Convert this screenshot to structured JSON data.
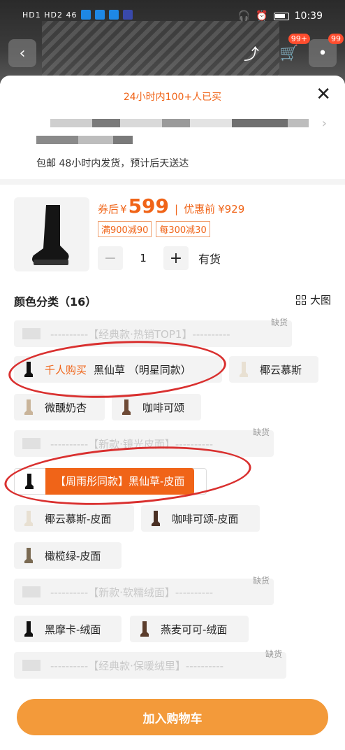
{
  "statusbar": {
    "signal_text": "HD1 HD2 46",
    "time": "10:39"
  },
  "header": {
    "back_icon": "back-arrow-icon",
    "share_icon": "share-icon",
    "cart_badge": "99+",
    "msg_badge": "99"
  },
  "sheet": {
    "sold_banner": "24小时内100+人已买",
    "shipping": "包邮 48小时内发货，预计后天送达"
  },
  "product": {
    "price_prefix": "券后",
    "currency": "¥",
    "price": "599",
    "divider": "|",
    "orig_label": "优惠前",
    "orig_price": "¥929",
    "coupons": [
      "满900减90",
      "每300减30"
    ],
    "quantity": "1",
    "stock": "有货"
  },
  "options": {
    "title": "颜色分类（16）",
    "bigview_label": "大图",
    "out_of_stock": "缺货",
    "header1": "----------【经典款·热销TOP1】----------",
    "hot_tag": "千人购买",
    "o1": "黑仙草 （明星同款）",
    "o2": "椰云慕斯",
    "o3": "微醺奶杏",
    "o4": "咖啡可颂",
    "header2": "----------【新款·镜光皮面】----------",
    "o5": "【周雨彤同款】黑仙草-皮面",
    "o6": "椰云慕斯-皮面",
    "o7": "咖啡可颂-皮面",
    "o8": "橄榄绿-皮面",
    "header3": "----------【新款·软糯绒面】----------",
    "o9": "黑摩卡-绒面",
    "o10": "燕麦可可-绒面",
    "header4": "----------【经典款·保暖绒里】----------"
  },
  "footer": {
    "add_to_cart": "加入购物车"
  },
  "colors": {
    "accent": "#f06418",
    "button": "#f39a3a",
    "circle": "#d9302f"
  }
}
